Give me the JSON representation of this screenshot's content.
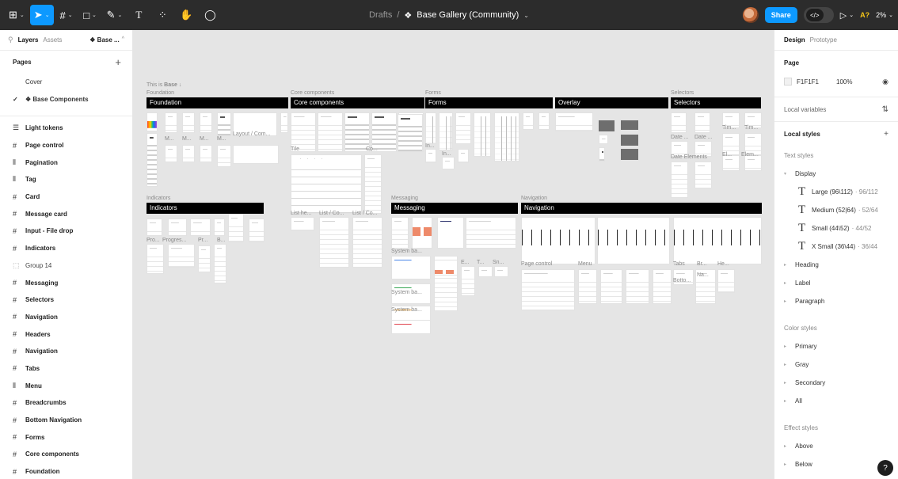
{
  "toolbar": {
    "breadcrumb_drafts": "Drafts",
    "separator": "/",
    "file_icon": "❖",
    "file_name": "Base Gallery (Community)",
    "share_label": "Share",
    "a11y_label": "A?",
    "zoom_label": "2%"
  },
  "left_panel": {
    "tab_layers": "Layers",
    "tab_assets": "Assets",
    "page_selector": "❖ Base ...",
    "pages_title": "Pages",
    "pages": [
      {
        "label": "Cover",
        "current": false
      },
      {
        "label": "❖ Base Components",
        "current": true
      }
    ],
    "layers": [
      {
        "icon": "☰",
        "label": "Light tokens"
      },
      {
        "icon": "#",
        "label": "Page control"
      },
      {
        "icon": "⦀",
        "label": "Pagination"
      },
      {
        "icon": "⦀",
        "label": "Tag"
      },
      {
        "icon": "#",
        "label": "Card"
      },
      {
        "icon": "#",
        "label": "Message card"
      },
      {
        "icon": "#",
        "label": "Input - File drop"
      },
      {
        "icon": "#",
        "label": "Indicators"
      },
      {
        "icon": "⬚",
        "label": "Group 14"
      },
      {
        "icon": "#",
        "label": "Messaging"
      },
      {
        "icon": "#",
        "label": "Selectors"
      },
      {
        "icon": "#",
        "label": "Navigation"
      },
      {
        "icon": "#",
        "label": "Headers"
      },
      {
        "icon": "#",
        "label": "Navigation"
      },
      {
        "icon": "#",
        "label": "Tabs"
      },
      {
        "icon": "⦀",
        "label": "Menu"
      },
      {
        "icon": "#",
        "label": "Breadcrumbs"
      },
      {
        "icon": "#",
        "label": "Bottom Navigation"
      },
      {
        "icon": "#",
        "label": "Forms"
      },
      {
        "icon": "#",
        "label": "Core components"
      },
      {
        "icon": "#",
        "label": "Foundation"
      }
    ]
  },
  "canvas": {
    "intro_prefix": "This is ",
    "intro_bold": "Base ↓",
    "sections": {
      "foundation": {
        "label": "Foundation",
        "bar": "Foundation"
      },
      "core": {
        "label": "Core components",
        "bar": "Core components"
      },
      "forms": {
        "label": "Forms",
        "bar": "Forms"
      },
      "overlay": {
        "bar": "Overlay"
      },
      "selectors": {
        "label": "Selectors",
        "bar": "Selectors"
      },
      "indicators": {
        "label": "Indicators",
        "bar": "Indicators"
      },
      "messaging": {
        "label": "Messaging",
        "bar": "Messaging"
      },
      "navigation": {
        "label": "Navigation",
        "bar": "Navigation"
      }
    },
    "frame_labels": {
      "m1": "M...",
      "m2": "M...",
      "m3": "M...",
      "m4": "M...",
      "layout": "Layout / Com...",
      "tile": "Tile",
      "co": "Co...",
      "in1": "In...",
      "in2": "In...",
      "tim1": "Tim...",
      "tim2": "Tim...",
      "date1": "Date ...",
      "date2": "Date ...",
      "date_elements": "Date Elements",
      "el": "El...",
      "elem": "Elem...",
      "list1": "List he...",
      "list2": "List / Co...",
      "list3": "List / Co...",
      "pro": "Pro...",
      "progress": "Progres...",
      "pr": "Pr...",
      "b": "B...",
      "system1": "System ba...",
      "system2": "System ba...",
      "system3": "System ba...",
      "e": "E...",
      "t": "T...",
      "sn": "Sn...",
      "page_control": "Page control",
      "menu": "Menu",
      "tabs": "Tabs",
      "br": "Br...",
      "he": "He...",
      "botto": "Botto...",
      "na": "Na..."
    }
  },
  "right_panel": {
    "tab_design": "Design",
    "tab_prototype": "Prototype",
    "page_title": "Page",
    "page_color": "F1F1F1",
    "page_opacity": "100%",
    "local_variables": "Local variables",
    "local_styles": "Local styles",
    "text_styles_title": "Text styles",
    "display_group": "Display",
    "text_styles": [
      {
        "name": "Large (96\\112)",
        "size": "· 96/112"
      },
      {
        "name": "Medium (52|64)",
        "size": "· 52/64"
      },
      {
        "name": "Small (44\\52)",
        "size": "· 44/52"
      },
      {
        "name": "X Small (36\\44)",
        "size": "· 36/44"
      }
    ],
    "text_groups": [
      "Heading",
      "Label",
      "Paragraph"
    ],
    "color_styles_title": "Color styles",
    "color_groups": [
      "Primary",
      "Gray",
      "Secondary",
      "All"
    ],
    "effect_styles_title": "Effect styles",
    "effect_groups": [
      "Above",
      "Below"
    ],
    "help_label": "?"
  },
  "colors": {
    "toolbar_bg": "#2c2c2c",
    "accent": "#0d99ff",
    "canvas_bg": "#e5e5e5",
    "section_bar": "#000000"
  }
}
